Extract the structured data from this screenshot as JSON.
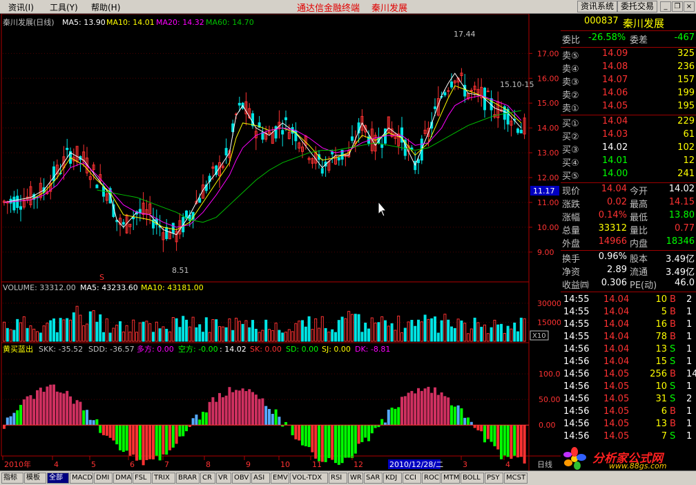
{
  "menu": {
    "items": [
      "资讯(I)",
      "工具(Y)",
      "帮助(H)"
    ],
    "title": "通达信金融终端",
    "stock": "秦川发展",
    "sys_buttons": [
      "资讯系统",
      "委托交易"
    ]
  },
  "header": {
    "name_period": "秦川发展(日线)",
    "ma5": "MA5: 13.90",
    "ma10": "MA10: 14.01",
    "ma20": "MA20: 14.32",
    "ma60": "MA60: 14.70"
  },
  "vol_header": {
    "label": "VOLUME: 33312.00",
    "ma5": "MA5: 43233.60",
    "ma10": "MA10: 43181.00"
  },
  "ind_header": {
    "name": "黄买蓝出",
    "skk": "SKK: -35.52",
    "sdd": "SDD: -36.57",
    "duo": "多方: 0.00",
    "kong": "空方: -0.00",
    "val": ": 14.02",
    "sk": "SK: 0.00",
    "sd": "SD: 0.00",
    "sj": "SJ: 0.00",
    "dk": "DK: -8.81"
  },
  "annot": {
    "high": "17.44",
    "low": "8.51",
    "right": "15.10-15",
    "cursor_price": "11.17",
    "x10": "X10",
    "period": "日线",
    "date_highlight": "2010/12/28/二",
    "s_mark": "S"
  },
  "colors": {
    "up": "#ff3232",
    "down": "#00e4e4",
    "ma5": "#ffffff",
    "ma10": "#ffff00",
    "ma20": "#ff00ff",
    "ma60": "#00c000",
    "frame": "#b00000",
    "green": "#00ff00",
    "skyblue": "#55aaff"
  },
  "chart_data": {
    "type": "candlestick",
    "price_axis": {
      "ticks": [
        "17.00",
        "16.00",
        "15.00",
        "14.00",
        "13.00",
        "12.00",
        "11.00",
        "10.00",
        "9.00"
      ],
      "ylim": [
        8.3,
        17.9
      ]
    },
    "volume_axis": {
      "ticks": [
        "30000",
        "15000"
      ],
      "ylim": [
        0,
        43000
      ]
    },
    "indicator_axis": {
      "ticks": [
        "100.00",
        "50.00",
        "0.00"
      ],
      "ylim": [
        -55,
        150
      ]
    },
    "x_ticks": [
      "2010年",
      "4",
      "5",
      "6",
      "7",
      "8",
      "9",
      "10",
      "11",
      "12",
      "3",
      "4"
    ],
    "ma_lines": [
      {
        "name": "MA5",
        "color": "#ffffff",
        "values": [
          [
            0,
            11
          ],
          [
            4,
            11.2
          ],
          [
            6,
            11.5
          ],
          [
            8,
            12.2
          ],
          [
            10,
            13
          ],
          [
            12,
            12.7
          ],
          [
            14,
            12
          ],
          [
            16,
            11.3
          ],
          [
            17,
            10.3
          ],
          [
            18,
            10
          ],
          [
            20,
            10.6
          ],
          [
            22,
            10.5
          ],
          [
            24,
            9.9
          ],
          [
            26,
            9.7
          ],
          [
            28,
            10.5
          ],
          [
            30,
            11.5
          ],
          [
            32,
            12.2
          ],
          [
            34,
            13
          ],
          [
            35,
            14.5
          ],
          [
            36,
            14.9
          ],
          [
            38,
            14
          ],
          [
            40,
            13.7
          ],
          [
            42,
            14.2
          ],
          [
            44,
            13.8
          ],
          [
            46,
            13.1
          ],
          [
            48,
            12.4
          ],
          [
            50,
            12.9
          ],
          [
            52,
            12.9
          ],
          [
            54,
            14.2
          ],
          [
            56,
            13.3
          ],
          [
            58,
            14
          ],
          [
            60,
            13.6
          ],
          [
            62,
            12.5
          ],
          [
            64,
            13.8
          ],
          [
            66,
            15.3
          ],
          [
            67,
            15.8
          ],
          [
            68,
            16.2
          ],
          [
            70,
            15.4
          ],
          [
            72,
            15.3
          ],
          [
            74,
            14.8
          ],
          [
            76,
            14.6
          ],
          [
            78,
            14
          ]
        ]
      },
      {
        "name": "MA10",
        "color": "#ffff00",
        "values": [
          [
            0,
            11
          ],
          [
            4,
            11.1
          ],
          [
            6,
            11.4
          ],
          [
            8,
            12
          ],
          [
            10,
            12.8
          ],
          [
            12,
            12.5
          ],
          [
            14,
            11.9
          ],
          [
            16,
            11.4
          ],
          [
            18,
            10.5
          ],
          [
            20,
            10.4
          ],
          [
            22,
            10.3
          ],
          [
            24,
            10
          ],
          [
            26,
            9.9
          ],
          [
            28,
            10.2
          ],
          [
            30,
            11
          ],
          [
            32,
            11.8
          ],
          [
            34,
            12.6
          ],
          [
            35,
            13.6
          ],
          [
            36,
            14.2
          ],
          [
            38,
            14.1
          ],
          [
            40,
            13.9
          ],
          [
            42,
            14
          ],
          [
            44,
            13.8
          ],
          [
            46,
            13.3
          ],
          [
            48,
            12.7
          ],
          [
            50,
            12.8
          ],
          [
            52,
            13
          ],
          [
            54,
            13.7
          ],
          [
            56,
            13.5
          ],
          [
            58,
            13.8
          ],
          [
            60,
            13.6
          ],
          [
            62,
            12.9
          ],
          [
            64,
            13.4
          ],
          [
            66,
            14.6
          ],
          [
            67,
            15.2
          ],
          [
            68,
            15.7
          ],
          [
            70,
            15.5
          ],
          [
            72,
            15.3
          ],
          [
            74,
            15
          ],
          [
            76,
            14.7
          ],
          [
            78,
            14.2
          ]
        ]
      },
      {
        "name": "MA20",
        "color": "#ff00ff",
        "values": [
          [
            0,
            11
          ],
          [
            4,
            11.1
          ],
          [
            6,
            11.3
          ],
          [
            8,
            11.7
          ],
          [
            10,
            12.4
          ],
          [
            12,
            12.6
          ],
          [
            14,
            12.1
          ],
          [
            16,
            11.5
          ],
          [
            18,
            10.9
          ],
          [
            20,
            10.6
          ],
          [
            22,
            10.5
          ],
          [
            24,
            10.2
          ],
          [
            26,
            10
          ],
          [
            28,
            10.1
          ],
          [
            30,
            10.6
          ],
          [
            32,
            11.3
          ],
          [
            34,
            12.1
          ],
          [
            35,
            12.7
          ],
          [
            36,
            13.2
          ],
          [
            38,
            13.7
          ],
          [
            40,
            13.9
          ],
          [
            42,
            14
          ],
          [
            44,
            13.9
          ],
          [
            46,
            13.6
          ],
          [
            48,
            13.2
          ],
          [
            50,
            13
          ],
          [
            52,
            13.1
          ],
          [
            54,
            13.4
          ],
          [
            56,
            13.6
          ],
          [
            58,
            13.7
          ],
          [
            60,
            13.7
          ],
          [
            62,
            13.3
          ],
          [
            64,
            13.4
          ],
          [
            66,
            14
          ],
          [
            67,
            14.5
          ],
          [
            68,
            14.9
          ],
          [
            70,
            15.2
          ],
          [
            72,
            15.3
          ],
          [
            74,
            15.1
          ],
          [
            76,
            14.9
          ],
          [
            78,
            14.3
          ]
        ]
      },
      {
        "name": "MA60",
        "color": "#00c000",
        "values": [
          [
            14,
            11.5
          ],
          [
            16,
            11.4
          ],
          [
            18,
            11.3
          ],
          [
            20,
            11.2
          ],
          [
            22,
            11
          ],
          [
            24,
            10.8
          ],
          [
            26,
            10.6
          ],
          [
            28,
            10.3
          ],
          [
            30,
            10.2
          ],
          [
            32,
            10.4
          ],
          [
            34,
            10.9
          ],
          [
            36,
            11.4
          ],
          [
            38,
            11.9
          ],
          [
            40,
            12.3
          ],
          [
            42,
            12.6
          ],
          [
            44,
            12.8
          ],
          [
            46,
            13
          ],
          [
            48,
            13.1
          ],
          [
            50,
            13.1
          ],
          [
            52,
            13.2
          ],
          [
            54,
            13.3
          ],
          [
            56,
            13.4
          ],
          [
            58,
            13.3
          ],
          [
            60,
            13.2
          ],
          [
            62,
            13.1
          ],
          [
            64,
            13.2
          ],
          [
            66,
            13.5
          ],
          [
            68,
            13.8
          ],
          [
            70,
            14.1
          ],
          [
            72,
            14.3
          ],
          [
            74,
            14.5
          ],
          [
            76,
            14.6
          ],
          [
            78,
            14.7
          ]
        ]
      }
    ]
  },
  "quote": {
    "code": "000837",
    "name": "秦川发展",
    "wb_label": "委比",
    "wb_val": "-26.58%",
    "wc_label": "委差",
    "wc_val": "-467",
    "sells": [
      {
        "l": "卖⑤",
        "p": "14.09",
        "v": "325"
      },
      {
        "l": "卖④",
        "p": "14.08",
        "v": "236"
      },
      {
        "l": "卖③",
        "p": "14.07",
        "v": "157"
      },
      {
        "l": "卖②",
        "p": "14.06",
        "v": "199"
      },
      {
        "l": "卖①",
        "p": "14.05",
        "v": "195"
      }
    ],
    "buys": [
      {
        "l": "买①",
        "p": "14.04",
        "v": "229"
      },
      {
        "l": "买②",
        "p": "14.03",
        "v": "61"
      },
      {
        "l": "买③",
        "p": "14.02",
        "v": "102"
      },
      {
        "l": "买④",
        "p": "14.01",
        "v": "12"
      },
      {
        "l": "买⑤",
        "p": "14.00",
        "v": "241"
      }
    ],
    "stats": [
      {
        "a": "现价",
        "av": "14.04",
        "b": "今开",
        "bv": "14.02"
      },
      {
        "a": "涨跌",
        "av": "0.02",
        "b": "最高",
        "bv": "14.15"
      },
      {
        "a": "涨幅",
        "av": "0.14%",
        "b": "最低",
        "bv": "13.80"
      },
      {
        "a": "总量",
        "av": "33312",
        "b": "量比",
        "bv": "0.77"
      },
      {
        "a": "外盘",
        "av": "14966",
        "b": "内盘",
        "bv": "18346"
      }
    ],
    "stats2": [
      {
        "a": "换手",
        "av": "0.96%",
        "b": "股本",
        "bv": "3.49亿"
      },
      {
        "a": "净资",
        "av": "2.89",
        "b": "流通",
        "bv": "3.49亿"
      },
      {
        "a": "收益㈣",
        "av": "0.306",
        "b": "PE(动)",
        "bv": "46.0"
      }
    ],
    "ticks": [
      {
        "t": "14:55",
        "p": "14.04",
        "v": "10",
        "d": "B",
        "x": "2"
      },
      {
        "t": "14:55",
        "p": "14.04",
        "v": "5",
        "d": "B",
        "x": "1"
      },
      {
        "t": "14:55",
        "p": "14.04",
        "v": "16",
        "d": "B",
        "x": "1"
      },
      {
        "t": "14:55",
        "p": "14.04",
        "v": "78",
        "d": "B",
        "x": "1"
      },
      {
        "t": "14:56",
        "p": "14.04",
        "v": "13",
        "d": "S",
        "x": "1"
      },
      {
        "t": "14:56",
        "p": "14.04",
        "v": "15",
        "d": "S",
        "x": "1"
      },
      {
        "t": "14:56",
        "p": "14.05",
        "v": "256",
        "d": "B",
        "x": "14"
      },
      {
        "t": "14:56",
        "p": "14.05",
        "v": "10",
        "d": "S",
        "x": "1"
      },
      {
        "t": "14:56",
        "p": "14.05",
        "v": "31",
        "d": "S",
        "x": "2"
      },
      {
        "t": "14:56",
        "p": "14.05",
        "v": "6",
        "d": "B",
        "x": "1"
      },
      {
        "t": "14:56",
        "p": "14.05",
        "v": "13",
        "d": "B",
        "x": "1"
      },
      {
        "t": "14:56",
        "p": "14.05",
        "v": "7",
        "d": "S",
        "x": "1"
      }
    ]
  },
  "logo": {
    "text": "分析家公式网",
    "url": "www.88gs.com"
  },
  "tabs": [
    "指标",
    "模板",
    "全部",
    "MACD",
    "DMI",
    "DMA",
    "FSL",
    "TRIX",
    "BRAR",
    "CR",
    "VR",
    "OBV",
    "ASI",
    "EMV",
    "VOL-TDX",
    "RSI",
    "WR",
    "SAR",
    "KDJ",
    "CCI",
    "ROC",
    "MTM",
    "BOLL",
    "PSY",
    "MCST"
  ]
}
